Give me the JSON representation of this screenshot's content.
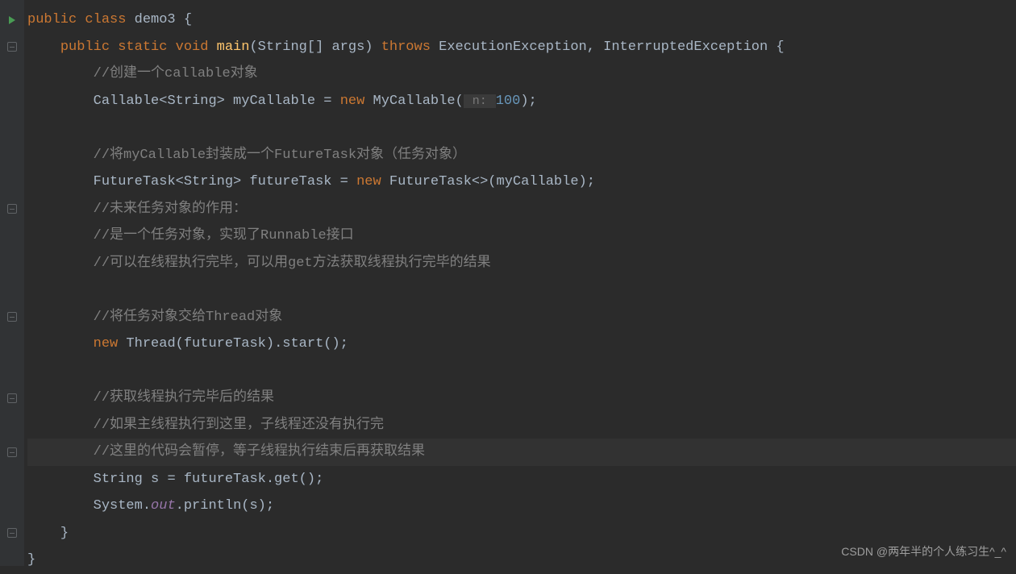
{
  "code": {
    "line1": {
      "kw1": "public class",
      "name": " demo3 {"
    },
    "line2": {
      "indent": "    ",
      "kw1": "public static void",
      "method": " main",
      "params": "(String[] args)",
      "kw2": " throws",
      "exceptions": " ExecutionException, InterruptedException {"
    },
    "line3": {
      "indent": "        ",
      "comment": "//创建一个callable对象"
    },
    "line4": {
      "indent": "        ",
      "text1": "Callable<String> myCallable = ",
      "kw": "new",
      "text2": " MyCallable(",
      "hint": " n: ",
      "num": "100",
      "text3": ");"
    },
    "line5": "",
    "line6": {
      "indent": "        ",
      "comment": "//将myCallable封装成一个FutureTask对象（任务对象）"
    },
    "line7": {
      "indent": "        ",
      "text1": "FutureTask<String> futureTask = ",
      "kw": "new",
      "text2": " FutureTask<>(myCallable);"
    },
    "line8": {
      "indent": "        ",
      "comment": "//未来任务对象的作用："
    },
    "line9": {
      "indent": "        ",
      "comment": "//是一个任务对象，实现了Runnable接口"
    },
    "line10": {
      "indent": "        ",
      "comment": "//可以在线程执行完毕，可以用get方法获取线程执行完毕的结果"
    },
    "line11": "",
    "line12": {
      "indent": "        ",
      "comment": "//将任务对象交给Thread对象"
    },
    "line13": {
      "indent": "        ",
      "kw": "new",
      "text": " Thread(futureTask).start();"
    },
    "line14": "",
    "line15": {
      "indent": "        ",
      "comment": "//获取线程执行完毕后的结果"
    },
    "line16": {
      "indent": "        ",
      "comment": "//如果主线程执行到这里，子线程还没有执行完"
    },
    "line17": {
      "indent": "        ",
      "comment": "//这里的代码会暂停，等子线程执行结束后再获取结果"
    },
    "line18": {
      "indent": "        ",
      "text": "String s = futureTask.get();"
    },
    "line19": {
      "indent": "        ",
      "text1": "System.",
      "field": "out",
      "text2": ".println(s);"
    },
    "line20": {
      "indent": "    ",
      "text": "}"
    },
    "line21": {
      "text": "}"
    }
  },
  "watermark": "CSDN @两年半的个人练习生^_^"
}
